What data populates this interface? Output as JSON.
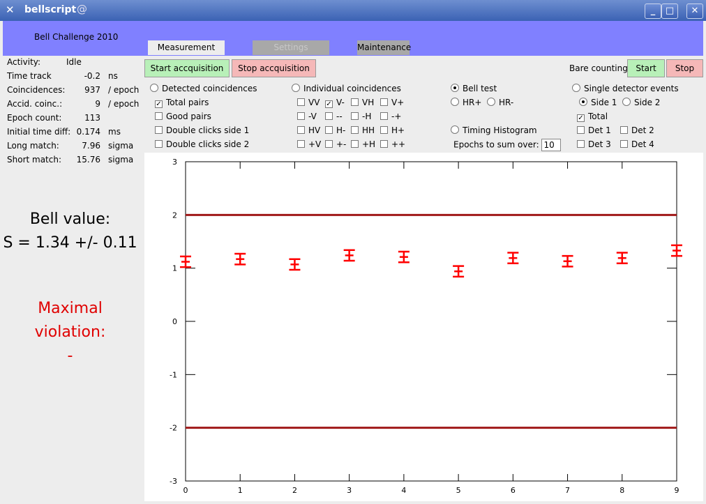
{
  "window": {
    "title": "bellscript",
    "minimize": "_",
    "maximize": "□",
    "close": "✕"
  },
  "header": {
    "brand": "Bell Challenge 2010"
  },
  "tabs": {
    "measurement": "Measurement",
    "settings": "Settings",
    "maintenance": "Maintenance"
  },
  "status": {
    "activity": {
      "label": "Activity:",
      "value": "Idle"
    },
    "rows": [
      {
        "label": "Time track",
        "value": "-0.2",
        "unit": "ns"
      },
      {
        "label": "Coincidences:",
        "value": "937",
        "unit": "/ epoch"
      },
      {
        "label": "Accid. coinc.:",
        "value": "9",
        "unit": "/ epoch"
      },
      {
        "label": "Epoch count:",
        "value": "113",
        "unit": ""
      },
      {
        "label": "Initial time diff:",
        "value": "0.174",
        "unit": "ms"
      },
      {
        "label": "Long match:",
        "value": "7.96",
        "unit": "sigma"
      },
      {
        "label": "Short match:",
        "value": "15.76",
        "unit": "sigma"
      }
    ]
  },
  "bell": {
    "line1": "Bell value:",
    "line2": "S = 1.34 +/- 0.11"
  },
  "maximal": {
    "line1": "Maximal",
    "line2": "violation:",
    "line3": "-"
  },
  "buttons": {
    "start_acq": "Start accquisition",
    "stop_acq": "Stop accquisition",
    "bare_label": "Bare counting:",
    "start": "Start",
    "stop": "Stop"
  },
  "options": {
    "detected": "Detected coincidences",
    "total_pairs": "Total pairs",
    "good_pairs": "Good pairs",
    "dc1": "Double clicks side 1",
    "dc2": "Double clicks side 2",
    "individual": "Individual coincidences",
    "ind": [
      "VV",
      "V-",
      "VH",
      "V+",
      "-V",
      "--",
      "-H",
      "-+",
      "HV",
      "H-",
      "HH",
      "H+",
      "+V",
      "+-",
      "+H",
      "++"
    ],
    "bell_test": "Bell test",
    "hrp": "HR+",
    "hrm": "HR-",
    "timing": "Timing Histogram",
    "epochs_label": "Epochs to sum over:",
    "epochs_value": "10",
    "single": "Single detector events",
    "side1": "Side 1",
    "side2": "Side 2",
    "total": "Total",
    "det1": "Det 1",
    "det2": "Det 2",
    "det3": "Det 3",
    "det4": "Det 4"
  },
  "checked": {
    "total_pairs": true,
    "vminus": true,
    "total": true
  },
  "chart_data": {
    "type": "scatter",
    "x": [
      0,
      1,
      2,
      3,
      4,
      5,
      6,
      7,
      8,
      9
    ],
    "y": [
      1.12,
      1.17,
      1.07,
      1.24,
      1.21,
      0.94,
      1.19,
      1.13,
      1.19,
      1.33
    ],
    "yerr": [
      0.1,
      0.1,
      0.1,
      0.1,
      0.1,
      0.1,
      0.1,
      0.1,
      0.1,
      0.1
    ],
    "hlines": [
      2,
      -2
    ],
    "xlim": [
      0,
      9
    ],
    "ylim": [
      -3,
      3
    ],
    "xticks": [
      "0",
      "1",
      "2",
      "3",
      "4",
      "5",
      "6",
      "7",
      "8",
      "9"
    ],
    "yticks": [
      "3",
      "2",
      "1",
      "0",
      "-1",
      "-2",
      "-3"
    ],
    "marker_color": "#ff0000",
    "line_color": "#a01818"
  }
}
